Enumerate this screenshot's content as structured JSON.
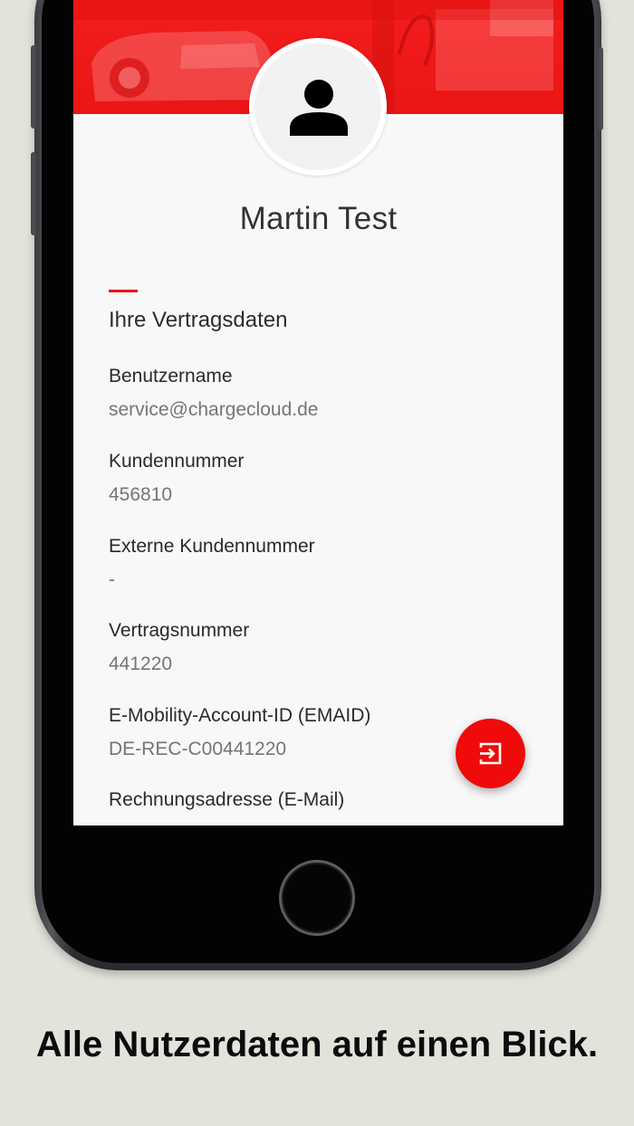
{
  "profile": {
    "name": "Martin Test",
    "avatar_icon": "person-icon"
  },
  "contract": {
    "section_title": "Ihre Vertragsdaten",
    "fields": [
      {
        "label": "Benutzername",
        "value": "service@chargecloud.de"
      },
      {
        "label": "Kundennummer",
        "value": "456810"
      },
      {
        "label": "Externe Kundennummer",
        "value": "-"
      },
      {
        "label": "Vertragsnummer",
        "value": "441220"
      },
      {
        "label": "E-Mobility-Account-ID (EMAID)",
        "value": "DE-REC-C00441220"
      },
      {
        "label": "Rechnungsadresse (E-Mail)",
        "value": ""
      }
    ]
  },
  "fab": {
    "icon": "logout-icon"
  },
  "caption": "Alle Nutzerdaten auf einen Blick.",
  "colors": {
    "brand_red": "#f00a0a",
    "accent_red": "#e8141a",
    "background": "#e2e4dc",
    "screen_bg": "#f8f8f8"
  }
}
